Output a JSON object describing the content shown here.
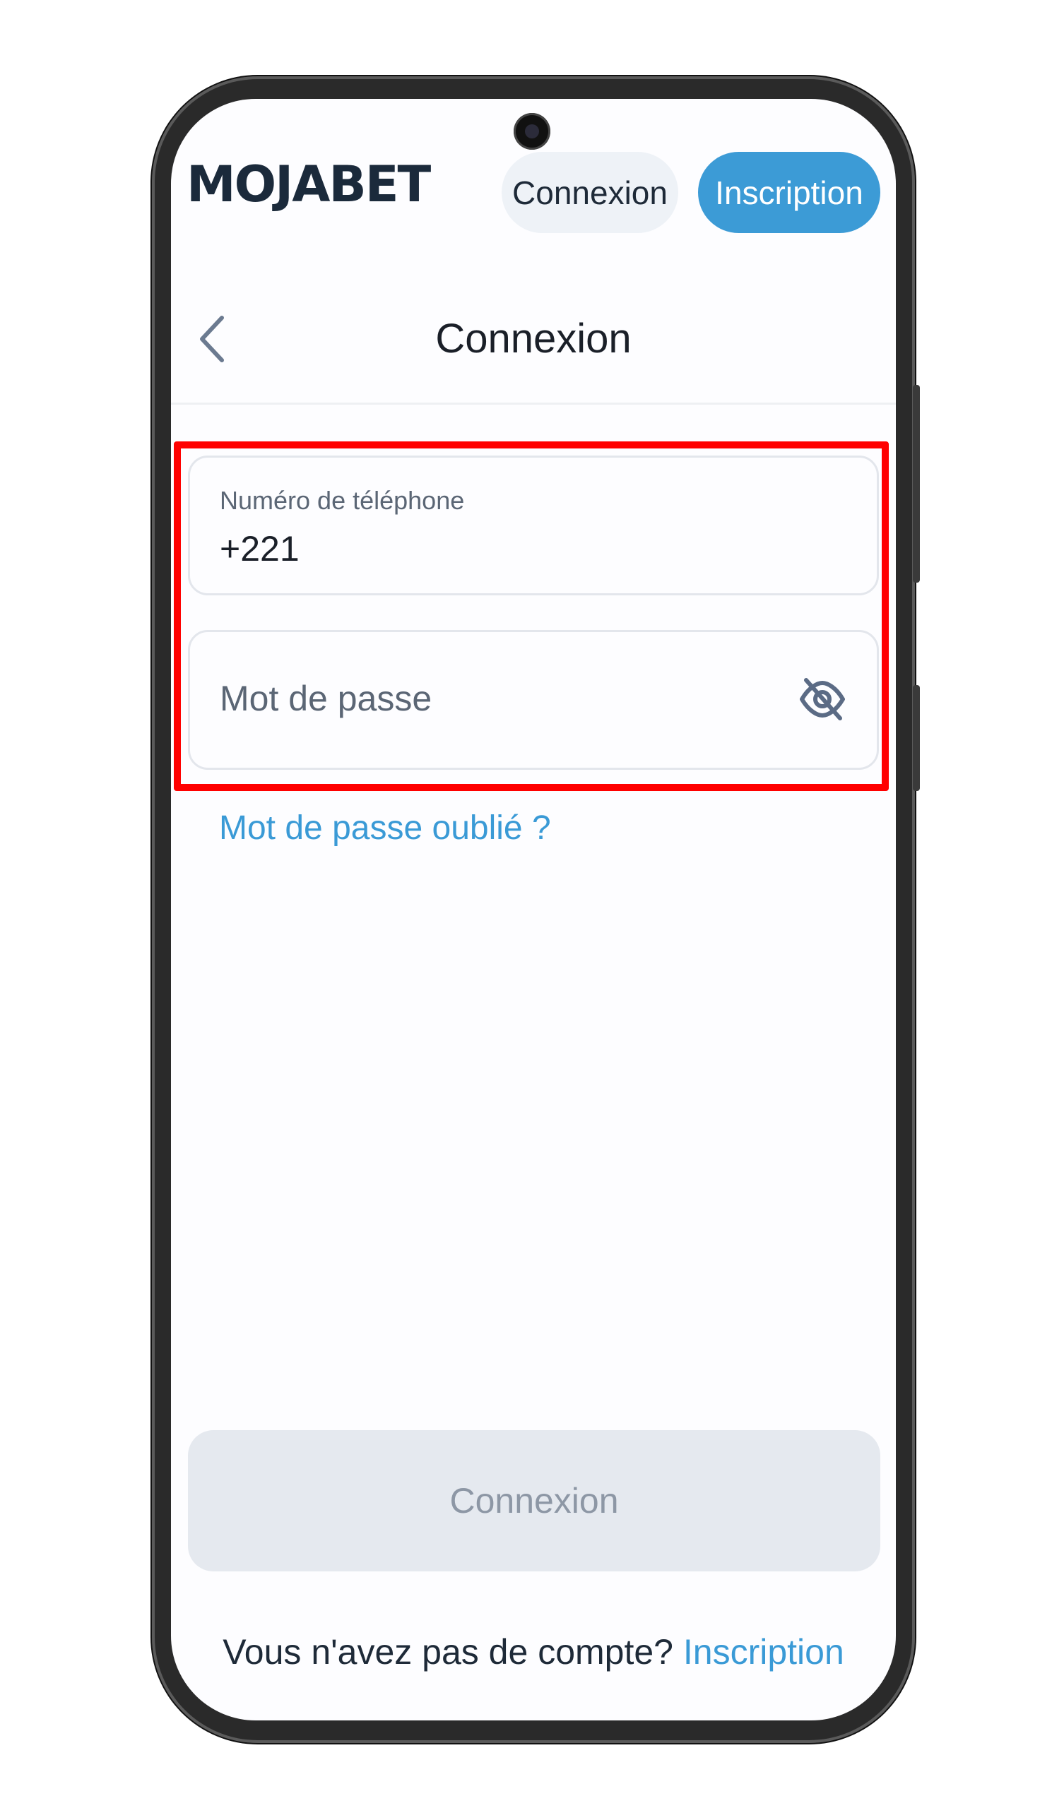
{
  "header": {
    "logo_text": "MOJABET",
    "login_button": "Connexion",
    "signup_button": "Inscription"
  },
  "title_bar": {
    "title": "Connexion",
    "back_icon": "chevron-left-icon"
  },
  "form": {
    "phone_label": "Numéro de téléphone",
    "phone_value": "+221",
    "password_placeholder": "Mot de passe",
    "password_toggle_icon": "eye-off-icon",
    "forgot_link": "Mot de passe oublié ?",
    "submit_button": "Connexion"
  },
  "footer": {
    "no_account_text": "Vous n'avez pas de compte?",
    "signup_link": "Inscription"
  },
  "colors": {
    "accent": "#3c9bd6",
    "highlight": "#ff0000",
    "disabled_button": "#e5e9ef"
  }
}
